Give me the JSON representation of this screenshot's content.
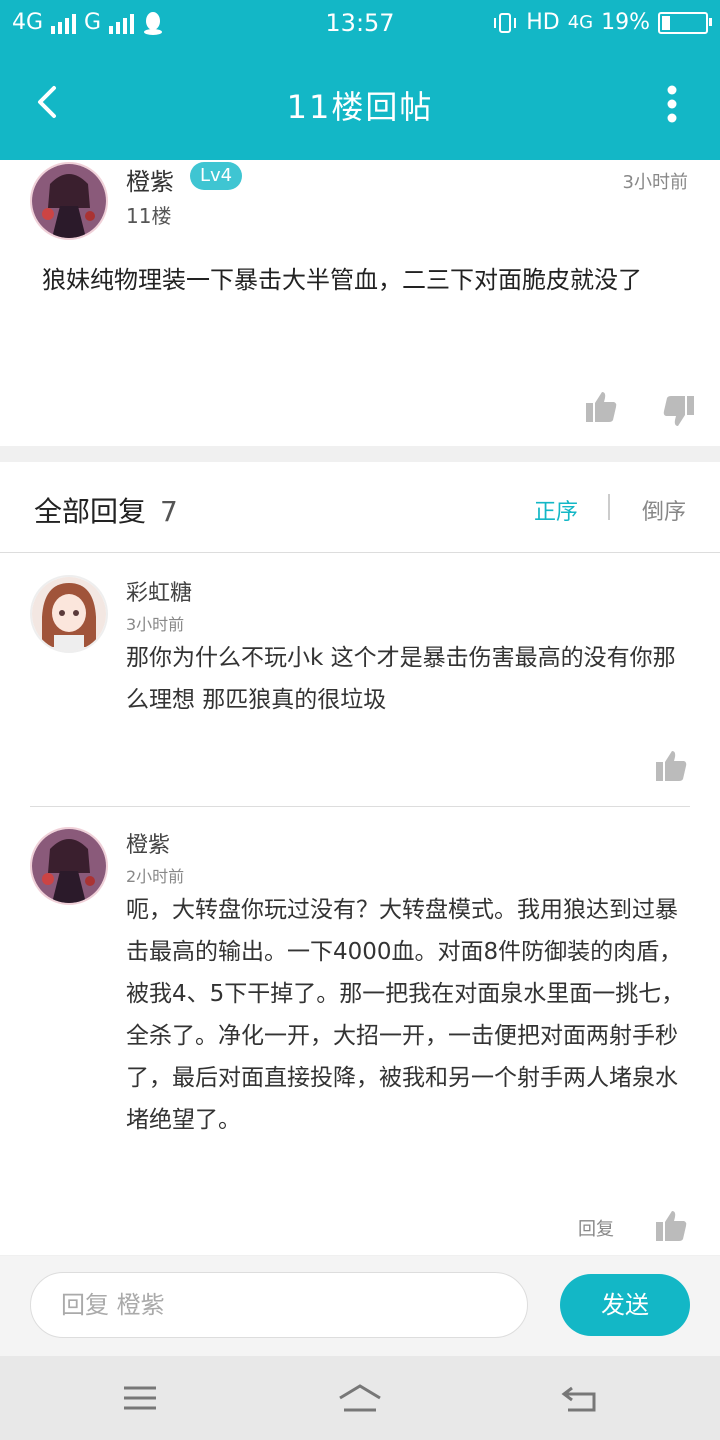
{
  "status_bar": {
    "net1": "4G",
    "net2": "G",
    "time": "13:57",
    "hd": "HD",
    "net3": "4G",
    "battery": "19%"
  },
  "header": {
    "title": "11楼回帖"
  },
  "post": {
    "author": "橙紫",
    "level": "Lv4",
    "floor": "11楼",
    "time": "3小时前",
    "content": "狼妹纯物理装一下暴击大半管血，二三下对面脆皮就没了"
  },
  "replies_header": {
    "label": "全部回复",
    "count": "7",
    "sort_asc": "正序",
    "sort_desc": "倒序"
  },
  "replies": [
    {
      "author": "彩虹糖",
      "time": "3小时前",
      "content": "那你为什么不玩小k 这个才是暴击伤害最高的没有你那么理想 那匹狼真的很垃圾"
    },
    {
      "author": "橙紫",
      "time": "2小时前",
      "content": "呃，大转盘你玩过没有？大转盘模式。我用狼达到过暴击最高的输出。一下4000血。对面8件防御装的肉盾，被我4、5下干掉了。那一把我在对面泉水里面一挑七，全杀了。净化一开，大招一开，一击便把对面两射手秒了，最后对面直接投降，被我和另一个射手两人堵泉水堵绝望了。",
      "reply_label": "回复"
    }
  ],
  "input": {
    "placeholder": "回复 橙紫",
    "send_label": "发送"
  },
  "colors": {
    "accent": "#13b7c6"
  }
}
